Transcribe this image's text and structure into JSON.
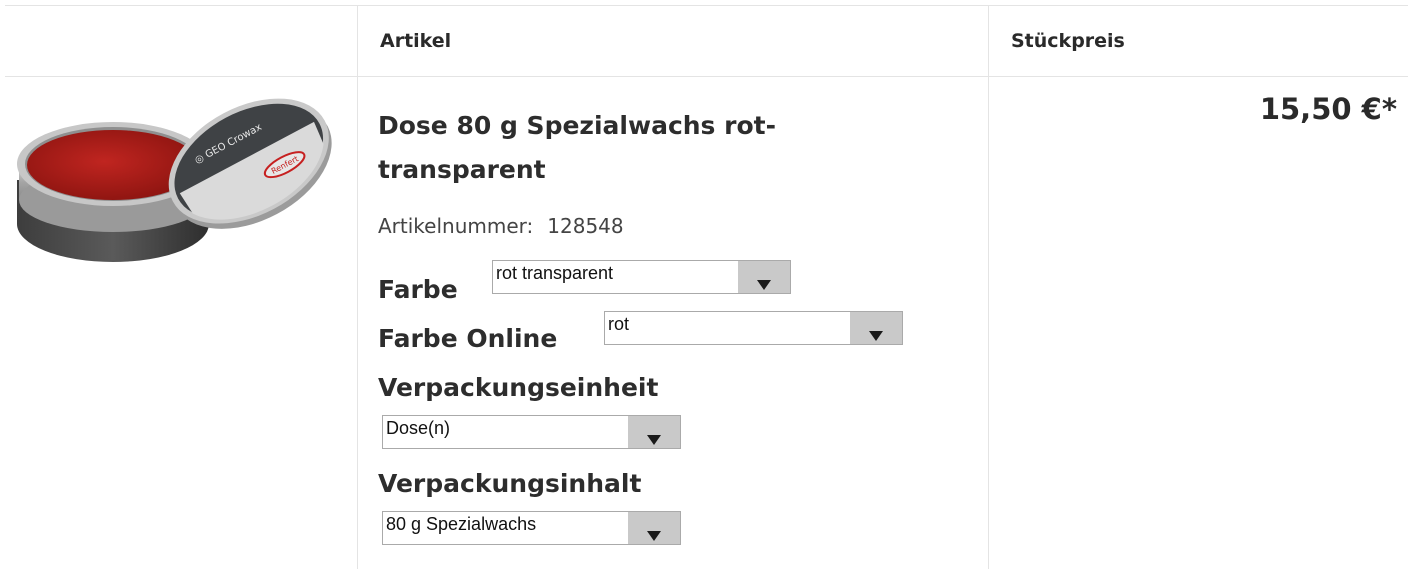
{
  "header": {
    "col_article": "Artikel",
    "col_unit_price": "Stückpreis"
  },
  "product": {
    "image_icon": "wax-tin-image",
    "title": "Dose 80 g Spezialwachs rot-transparent",
    "article_number_label": "Artikelnummer:",
    "article_number": "128548",
    "price": "15,50 €*",
    "options": {
      "farbe": {
        "label": "Farbe",
        "value": "rot transparent"
      },
      "farbe_online": {
        "label": "Farbe Online",
        "value": "rot"
      },
      "verpackungseinheit": {
        "label": "Verpackungseinheit",
        "value": "Dose(n)"
      },
      "verpackungsinhalt": {
        "label": "Verpackungsinhalt",
        "value": "80 g Spezialwachs"
      }
    }
  },
  "colors": {
    "border": "#e4e4e4",
    "wax_red": "#b01c17",
    "select_arrow_bg": "#c9c9c9"
  }
}
